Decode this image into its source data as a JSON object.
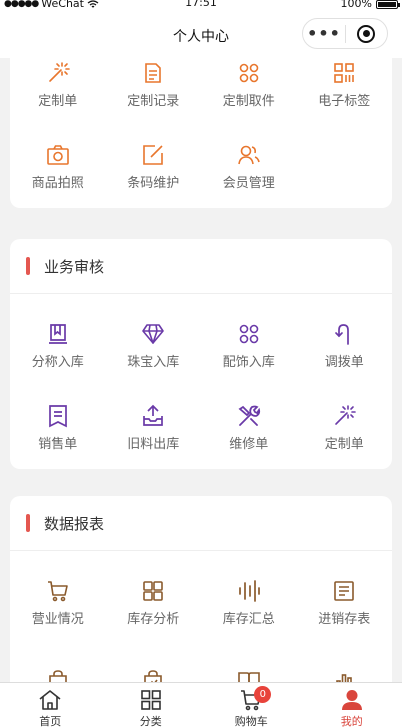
{
  "status_bar": {
    "carrier": "WeChat",
    "time": "17:51",
    "battery": "100%"
  },
  "nav": {
    "title": "个人中心",
    "more_label": "•••"
  },
  "colors": {
    "orange": "#e8762d",
    "purple": "#6a3aa8",
    "brown": "#8a5a2c",
    "accent_red": "#e45750",
    "tab_active": "#d9453c"
  },
  "section_custom": {
    "items": [
      {
        "label": "定制单",
        "icon": "magic-wand-icon"
      },
      {
        "label": "定制记录",
        "icon": "document-icon"
      },
      {
        "label": "定制取件",
        "icon": "grid-circles-icon"
      },
      {
        "label": "电子标签",
        "icon": "barcode-tag-icon"
      },
      {
        "label": "商品拍照",
        "icon": "camera-icon"
      },
      {
        "label": "条码维护",
        "icon": "edit-icon"
      },
      {
        "label": "会员管理",
        "icon": "members-icon"
      }
    ]
  },
  "section_review": {
    "title": "业务审核",
    "items": [
      {
        "label": "分称入库",
        "icon": "book-icon"
      },
      {
        "label": "珠宝入库",
        "icon": "diamond-icon"
      },
      {
        "label": "配饰入库",
        "icon": "grid-circles-icon"
      },
      {
        "label": "调拨单",
        "icon": "transfer-icon"
      },
      {
        "label": "销售单",
        "icon": "bookmark-list-icon"
      },
      {
        "label": "旧料出库",
        "icon": "tray-out-icon"
      },
      {
        "label": "维修单",
        "icon": "tools-icon"
      },
      {
        "label": "定制单",
        "icon": "magic-wand-icon"
      }
    ]
  },
  "section_reports": {
    "title": "数据报表",
    "items": [
      {
        "label": "营业情况",
        "icon": "cart-icon"
      },
      {
        "label": "库存分析",
        "icon": "blocks-icon"
      },
      {
        "label": "库存汇总",
        "icon": "bars-icon"
      },
      {
        "label": "进销存表",
        "icon": "ledger-icon"
      },
      {
        "label": "",
        "icon": "bag-icon"
      },
      {
        "label": "",
        "icon": "bag-chart-icon"
      },
      {
        "label": "",
        "icon": "open-book-icon"
      },
      {
        "label": "",
        "icon": "bar-chart-icon"
      }
    ]
  },
  "tabs": [
    {
      "label": "首页",
      "icon": "home-icon"
    },
    {
      "label": "分类",
      "icon": "category-icon"
    },
    {
      "label": "购物车",
      "icon": "cart-icon",
      "badge": "0"
    },
    {
      "label": "我的",
      "icon": "user-icon",
      "active": true
    }
  ]
}
